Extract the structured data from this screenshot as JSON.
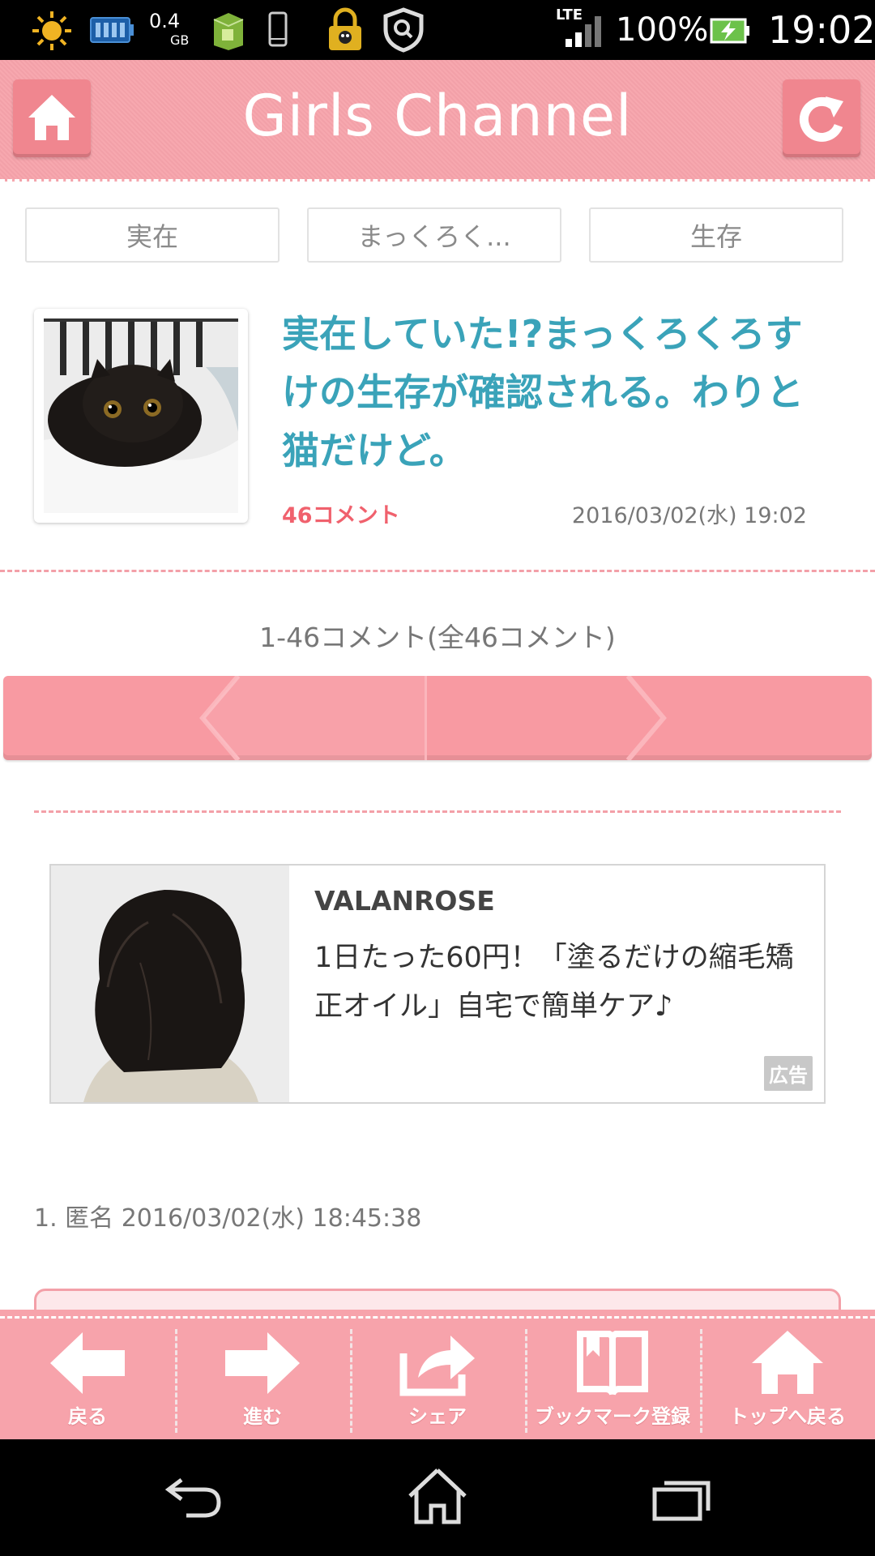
{
  "status_bar": {
    "storage_value": "0.4",
    "storage_unit": "GB",
    "network": "LTE",
    "battery": "100%",
    "time": "19:02",
    "icons": [
      "sun-icon",
      "battery-saver-icon",
      "storage-icon",
      "app-icon",
      "phone-icon",
      "lock-icon",
      "shield-icon",
      "signal-icon",
      "battery-icon"
    ]
  },
  "header": {
    "title": "Girls Channel",
    "left_button_icon": "home-icon",
    "right_button_icon": "refresh-icon"
  },
  "tags": [
    "実在",
    "まっくろく...",
    "生存"
  ],
  "article": {
    "title": "実在していた!?まっくろくろすけの生存が確認される。わりと猫だけど。",
    "comment_count": "46コメント",
    "date": "2016/03/02(水) 19:02"
  },
  "comments_range": "1-46コメント(全46コメント)",
  "pager": {
    "prev_icon": "chevron-left-icon",
    "next_icon": "chevron-right-icon"
  },
  "ad": {
    "brand": "VALANROSE",
    "text": "1日たった60円！「塗るだけの縮毛矯正オイル」自宅で簡単ケア♪",
    "badge": "広告"
  },
  "first_comment": {
    "meta": "1. 匿名 2016/03/02(水) 18:45:38"
  },
  "toolbar": {
    "items": [
      {
        "label": "戻る",
        "icon": "arrow-left-icon"
      },
      {
        "label": "進む",
        "icon": "arrow-right-icon"
      },
      {
        "label": "シェア",
        "icon": "share-icon"
      },
      {
        "label": "ブックマーク登録",
        "icon": "bookmark-icon"
      },
      {
        "label": "トップへ戻る",
        "icon": "home-icon"
      }
    ]
  },
  "nav_bar": {
    "icons": [
      "back-icon",
      "home-icon",
      "recents-icon"
    ]
  },
  "colors": {
    "brand_pink": "#f7a3ab",
    "title_teal": "#3aa3b9",
    "comment_red": "#f0616d"
  }
}
